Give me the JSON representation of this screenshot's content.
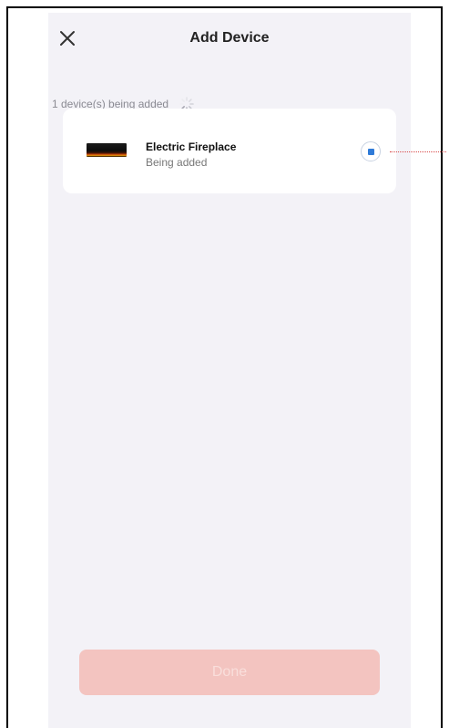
{
  "header": {
    "title": "Add Device",
    "close_icon": "close-icon"
  },
  "status": {
    "text": "1 device(s) being added",
    "spinner_icon": "loading-spinner-icon"
  },
  "device": {
    "name": "Electric Fireplace",
    "status": "Being added",
    "image_icon": "electric-fireplace-image",
    "stop_icon": "stop-icon"
  },
  "footer": {
    "done_label": "Done",
    "done_enabled": false
  },
  "colors": {
    "background": "#f3f2f7",
    "card": "#ffffff",
    "accent": "#2f7bd8",
    "done_button": "#f3c4c0",
    "annotation": "#d94a4a"
  }
}
